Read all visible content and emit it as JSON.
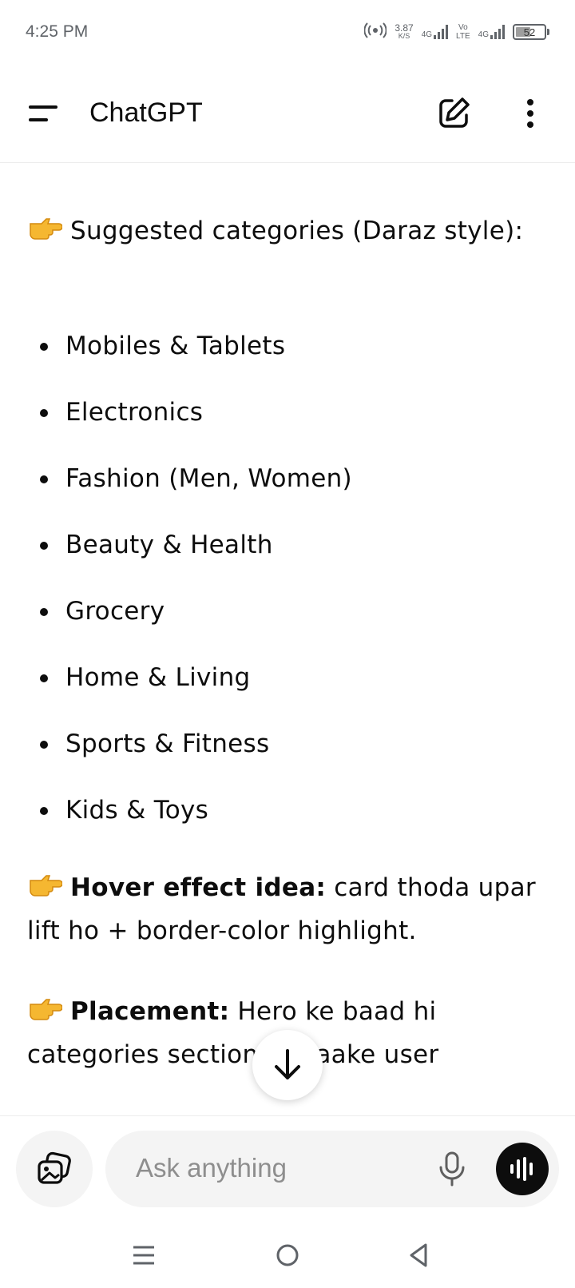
{
  "status_bar": {
    "time": "4:25 PM",
    "net_speed_value": "3.87",
    "net_speed_unit": "K/S",
    "network_1": "4G",
    "volte": "Vo\nLTE",
    "network_2": "4G",
    "battery": "52",
    "battery_level": 0.52
  },
  "header": {
    "title": "ChatGPT",
    "icons": [
      "menu-icon",
      "new-chat-icon",
      "more-vertical-icon"
    ]
  },
  "content": {
    "intro_emoji": "backhand-index-pointing-right",
    "intro": "Suggested categories (Daraz style):",
    "categories": [
      "Mobiles & Tablets",
      "Electronics",
      "Fashion (Men, Women)",
      "Beauty & Health",
      "Grocery",
      "Home & Living",
      "Sports & Fitness",
      "Kids & Toys"
    ],
    "hover_label": "Hover effect idea:",
    "hover_text": " card thoda upar lift ho + border-color highlight.",
    "placement_label": "Placement:",
    "placement_text": " Hero ke baad hi categories section ho taake user"
  },
  "composer": {
    "placeholder": "Ask anything",
    "icons": [
      "attach-image-icon",
      "microphone-icon",
      "voice-mode-icon"
    ]
  },
  "nav_bar": {
    "icons": [
      "recents-icon",
      "home-icon",
      "back-icon"
    ]
  },
  "colors": {
    "text": "#0d0d0d",
    "muted": "#8e8e8e",
    "input_bg": "#f4f4f4",
    "emoji_yellow": "#f5b731"
  }
}
